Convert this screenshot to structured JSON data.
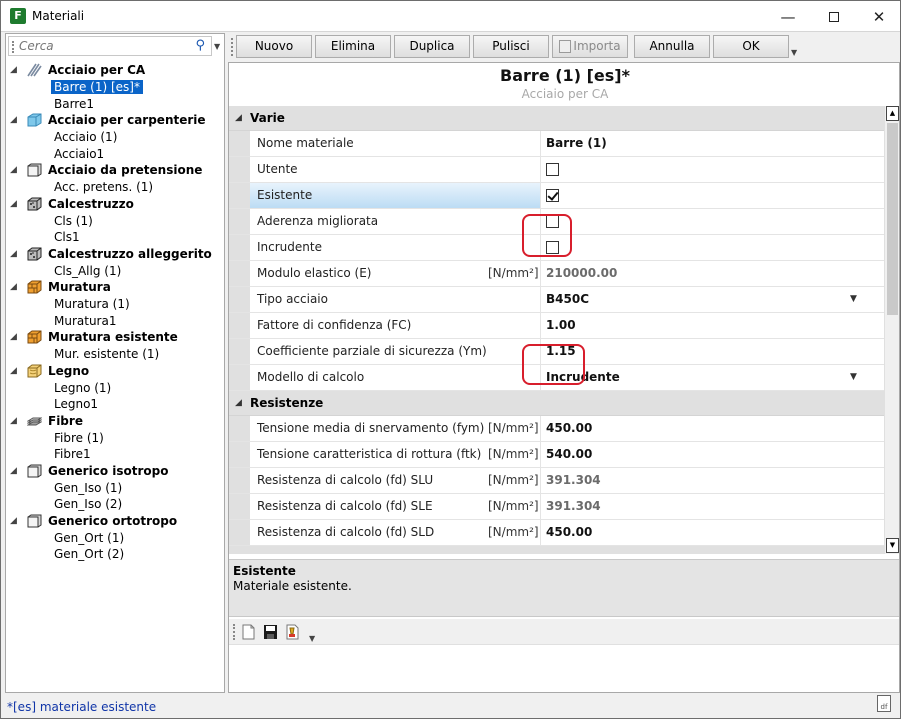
{
  "window": {
    "title": "Materiali",
    "logo_text": "F"
  },
  "search": {
    "placeholder": "Cerca"
  },
  "tree": [
    {
      "label": "Acciaio per CA",
      "icon": "rebar-icon",
      "children": [
        {
          "label": "Barre (1) [es]*",
          "selected": true
        },
        {
          "label": "Barre1"
        }
      ]
    },
    {
      "label": "Acciaio per carpenterie",
      "icon": "steel-block-icon",
      "children": [
        {
          "label": "Acciaio (1)"
        },
        {
          "label": "Acciaio1"
        }
      ]
    },
    {
      "label": "Acciaio da pretensione",
      "icon": "box-icon",
      "children": [
        {
          "label": "Acc. pretens. (1)"
        }
      ]
    },
    {
      "label": "Calcestruzzo",
      "icon": "concrete-cube-icon",
      "children": [
        {
          "label": "Cls (1)"
        },
        {
          "label": "Cls1"
        }
      ]
    },
    {
      "label": "Calcestruzzo alleggerito",
      "icon": "concrete-cube-icon",
      "children": [
        {
          "label": "Cls_Allg (1)"
        }
      ]
    },
    {
      "label": "Muratura",
      "icon": "masonry-icon",
      "children": [
        {
          "label": "Muratura (1)"
        },
        {
          "label": "Muratura1"
        }
      ]
    },
    {
      "label": "Muratura esistente",
      "icon": "masonry-icon",
      "children": [
        {
          "label": "Mur. esistente (1)"
        }
      ]
    },
    {
      "label": "Legno",
      "icon": "wood-icon",
      "children": [
        {
          "label": "Legno (1)"
        },
        {
          "label": "Legno1"
        }
      ]
    },
    {
      "label": "Fibre",
      "icon": "fibre-icon",
      "children": [
        {
          "label": "Fibre (1)"
        },
        {
          "label": "Fibre1"
        }
      ]
    },
    {
      "label": "Generico isotropo",
      "icon": "box-icon",
      "children": [
        {
          "label": "Gen_Iso (1)"
        },
        {
          "label": "Gen_Iso (2)"
        }
      ]
    },
    {
      "label": "Generico ortotropo",
      "icon": "box-icon",
      "children": [
        {
          "label": "Gen_Ort (1)"
        },
        {
          "label": "Gen_Ort (2)"
        }
      ]
    }
  ],
  "toolbar": {
    "nuovo": "Nuovo",
    "elimina": "Elimina",
    "duplica": "Duplica",
    "pulisci": "Pulisci",
    "importa": "Importa",
    "annulla": "Annulla",
    "ok": "OK"
  },
  "material": {
    "title": "Barre (1) [es]*",
    "subtitle": "Acciaio per CA"
  },
  "sections": {
    "varie": "Varie",
    "resistenze": "Resistenze"
  },
  "rows": {
    "nome_materiale": {
      "name": "Nome materiale",
      "value": "Barre (1)"
    },
    "utente": {
      "name": "Utente",
      "checked": false
    },
    "esistente": {
      "name": "Esistente",
      "checked": true
    },
    "aderenza": {
      "name": "Aderenza migliorata",
      "checked": false
    },
    "incrudente": {
      "name": "Incrudente",
      "checked": false
    },
    "modulo_elastico": {
      "name": "Modulo elastico (E)",
      "unit": "[N/mm²]",
      "value": "210000.00"
    },
    "tipo_acciaio": {
      "name": "Tipo acciaio",
      "value": "B450C"
    },
    "fc": {
      "name": "Fattore di confidenza (FC)",
      "value": "1.00"
    },
    "ym": {
      "name": "Coefficiente parziale di sicurezza (Ym)",
      "value": "1.15"
    },
    "modello": {
      "name": "Modello di calcolo",
      "value": "Incrudente"
    },
    "fym": {
      "name": "Tensione media di snervamento (fym)",
      "unit": "[N/mm²]",
      "value": "450.00"
    },
    "ftk": {
      "name": "Tensione caratteristica di rottura (ftk)",
      "unit": "[N/mm²]",
      "value": "540.00"
    },
    "fd_slu": {
      "name": "Resistenza di calcolo (fd) SLU",
      "unit": "[N/mm²]",
      "value": "391.304"
    },
    "fd_sle": {
      "name": "Resistenza di calcolo (fd) SLE",
      "unit": "[N/mm²]",
      "value": "391.304"
    },
    "fd_sld": {
      "name": "Resistenza di calcolo (fd) SLD",
      "unit": "[N/mm²]",
      "value": "450.00"
    }
  },
  "help": {
    "title": "Esistente",
    "description": "Materiale esistente."
  },
  "footer": {
    "legend": "*[es] materiale esistente"
  },
  "accent": {
    "selection": "#0a64c8",
    "highlight_box": "#d81e2c"
  }
}
